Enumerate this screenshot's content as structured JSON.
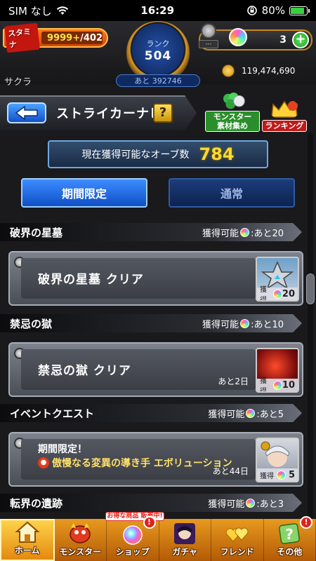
{
  "status_bar": {
    "carrier": "SIM なし",
    "time": "16:29",
    "battery": "80%",
    "battery_level": 0.8
  },
  "header": {
    "stamina_label": "スタミナ",
    "stamina_current": "9999+",
    "stamina_max": "/402",
    "rank_label": "ランク",
    "rank_value": "504",
    "rank_remaining": "あと 392746",
    "gift_label": "---",
    "orb_count": "3",
    "player_name": "サクラ",
    "coins": "119,474,690"
  },
  "title_bar": {
    "back_icon": "back-arrow-icon",
    "title": "ストライカーナビ",
    "help_label": "?",
    "monster_material_label": "モンスター 素材集め",
    "ranking_label": "ランキング"
  },
  "orb_summary": {
    "label": "現在獲得可能なオーブ数",
    "value": "784"
  },
  "tabs": [
    {
      "label": "期間限定",
      "active": true
    },
    {
      "label": "通常",
      "active": false
    }
  ],
  "sections": [
    {
      "name": "破界の星墓",
      "available_prefix": "獲得可能",
      "available_suffix": ":あと20",
      "quest": {
        "title": "破界の星墓 クリア",
        "remain": "",
        "reward_label": "獲得",
        "reward_count": "20"
      }
    },
    {
      "name": "禁忌の獄",
      "available_prefix": "獲得可能",
      "available_suffix": ":あと10",
      "quest": {
        "title": "禁忌の獄 クリア",
        "remain": "あと2日",
        "reward_label": "獲得",
        "reward_count": "10"
      }
    },
    {
      "name": "イベントクエスト",
      "available_prefix": "獲得可能",
      "available_suffix": ":あと5",
      "quest": {
        "line1": "期間限定！",
        "line2": "傲慢なる変異の導き手 エボリューション",
        "remain": "あと44日",
        "reward_label": "獲得",
        "reward_count": "5"
      }
    },
    {
      "name": "転界の遺跡",
      "available_prefix": "獲得可能",
      "available_suffix": ":あと3"
    }
  ],
  "bottom_nav": [
    {
      "label": "ホーム",
      "active": true
    },
    {
      "label": "モンスター",
      "active": false
    },
    {
      "label": "ショップ",
      "active": false,
      "promo": "お得な商品 販売中!",
      "badge": "!"
    },
    {
      "label": "ガチャ",
      "active": false
    },
    {
      "label": "フレンド",
      "active": false
    },
    {
      "label": "その他",
      "active": false,
      "badge": "!"
    }
  ],
  "colors": {
    "accent_blue": "#3d8cff",
    "orb_value": "#ffd930",
    "nav_orange": "#e89a1f"
  }
}
